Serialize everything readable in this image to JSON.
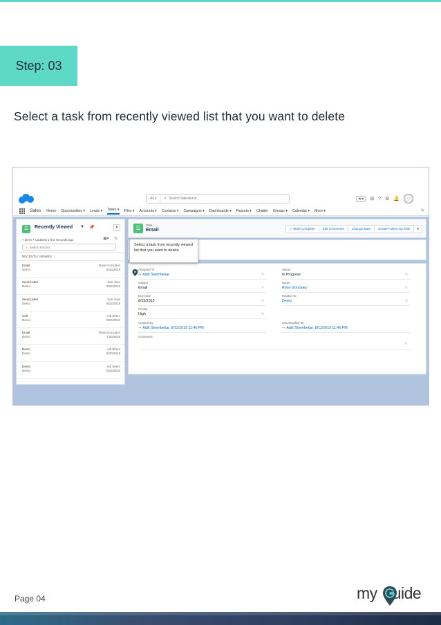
{
  "step": {
    "label": "Step: 03"
  },
  "instruction": "Select a task from recently viewed list that you want to delete",
  "sf": {
    "search_scope": "All ▾",
    "search_placeholder": "Search Salesforce",
    "app_name": "Sales",
    "nav": [
      "Home",
      "Opportunities ▾",
      "Leads ▾",
      "Tasks ▾",
      "Files ▾",
      "Accounts ▾",
      "Contacts ▾",
      "Campaigns ▾",
      "Dashboards ▾",
      "Reports ▾",
      "Chatter",
      "Groups ▾",
      "Calendar ▾",
      "More ▾"
    ],
    "list": {
      "title": "Recently Viewed",
      "subtitle": "7 items • Updated a few seconds ago",
      "search_placeholder": "Search this list...",
      "column_header": "RECENTLY VIEWED",
      "rows": [
        {
          "subject": "Email",
          "related": "Demo",
          "name": "Rose Gonzalez",
          "date": "8/15/2019"
        },
        {
          "subject": "Send Letter",
          "related": "Demo",
          "name": "San Jose",
          "date": "8/22/2019"
        },
        {
          "subject": "Send Letter",
          "related": "Demo",
          "name": "San Jose",
          "date": "8/22/2019"
        },
        {
          "subject": "Call",
          "related": "Demo",
          "name": "Adi Shem",
          "date": "9/26/2019"
        },
        {
          "subject": "Email",
          "related": "Demo",
          "name": "Rose Gonzalez",
          "date": "7/26/2019"
        },
        {
          "subject": "Demo",
          "related": "Demo",
          "name": "Adi Shem",
          "date": "6/30/2019"
        },
        {
          "subject": "Demo",
          "related": "Demo",
          "name": "Adi Shem",
          "date": "5/24/2019"
        }
      ]
    },
    "record": {
      "object_label": "Task",
      "name": "Email",
      "actions": [
        "✓ Mark Complete",
        "Edit Comments",
        "Change Date",
        "Create Follow-Up Task"
      ],
      "fields": {
        "assigned_to_label": "Assigned To",
        "assigned_to": "Aditi Shembekar",
        "status_label": "Status",
        "status": "In Progress",
        "subject_label": "Subject",
        "subject": "Email",
        "name_label": "Name",
        "name": "Rose Gonzalez",
        "due_date_label": "Due Date",
        "due_date": "8/15/2019",
        "related_to_label": "Related To",
        "related_to": "Demo",
        "priority_label": "Priority",
        "priority": "High",
        "created_by_label": "Created By",
        "created_by": "Aditi Shembekar, 8/11/2019 11:46 PM",
        "last_modified_label": "Last Modified By",
        "last_modified": "Aditi Shembekar, 8/11/2019 11:46 PM",
        "comments_label": "Comments"
      }
    },
    "tooltip": "Select a task from recently viewed list that you want to delete"
  },
  "footer": {
    "page": "Page 04",
    "brand_prefix": "my",
    "brand_suffix": "uide"
  },
  "colors": {
    "accent": "#5ed9c8",
    "sf_blue": "#0070d2",
    "sf_green": "#4bc076"
  }
}
